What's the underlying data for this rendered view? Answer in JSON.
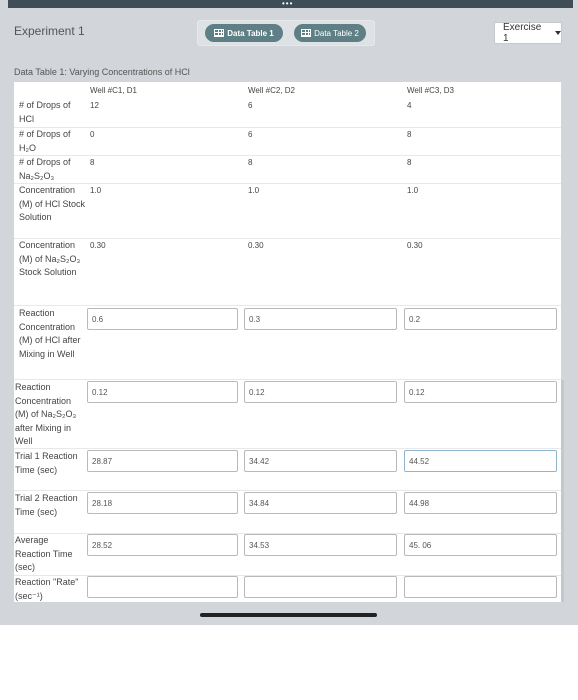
{
  "header": {
    "title": "Experiment 1",
    "tabs": [
      {
        "label": "Data Table 1",
        "active": true
      },
      {
        "label": "Data Table 2",
        "active": false
      }
    ],
    "exercise_select": "Exercise 1"
  },
  "table": {
    "title": "Data Table 1: Varying Concentrations of HCl",
    "columns": [
      "Well #C1, D1",
      "Well #C2, D2",
      "Well #C3, D3"
    ],
    "rows": [
      {
        "label": "# of Drops of HCl",
        "values": [
          "12",
          "6",
          "4"
        ],
        "type": "text"
      },
      {
        "label": "# of Drops of H₂O",
        "values": [
          "0",
          "6",
          "8"
        ],
        "type": "text"
      },
      {
        "label": "# of Drops of Na₂S₂O₃",
        "values": [
          "8",
          "8",
          "8"
        ],
        "type": "text"
      },
      {
        "label": "Concentration (M) of HCl Stock Solution",
        "values": [
          "1.0",
          "1.0",
          "1.0"
        ],
        "type": "text"
      },
      {
        "label": "Concentration (M) of Na₂S₂O₃ Stock Solution",
        "values": [
          "0.30",
          "0.30",
          "0.30"
        ],
        "type": "text"
      },
      {
        "label": "Reaction Concentration (M) of HCl after Mixing in Well",
        "values": [
          "0.6",
          "0.3",
          "0.2"
        ],
        "type": "input"
      },
      {
        "label": "Reaction Concentration (M) of Na₂S₂O₃ after Mixing in Well",
        "values": [
          "0.12",
          "0.12",
          "0.12"
        ],
        "type": "input"
      },
      {
        "label": "Trial 1 Reaction Time (sec)",
        "values": [
          "28.87",
          "34.42",
          "44.52"
        ],
        "type": "input"
      },
      {
        "label": "Trial 2 Reaction Time (sec)",
        "values": [
          "28.18",
          "34.84",
          "44.98"
        ],
        "type": "input"
      },
      {
        "label": "Average Reaction Time (sec)",
        "values": [
          "28.52",
          "34.53",
          "45. 06"
        ],
        "type": "input"
      },
      {
        "label": "Reaction \"Rate\" (sec⁻¹)",
        "values": [
          "",
          "",
          ""
        ],
        "type": "input"
      }
    ]
  },
  "colors": {
    "tab_active": "#5e7f86",
    "background": "#d2d5d9",
    "topbar": "#3f4d56"
  }
}
